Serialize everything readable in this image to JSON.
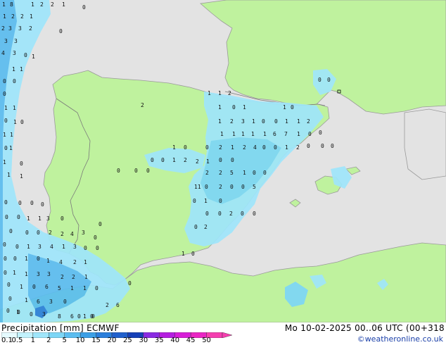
{
  "map": {
    "colors": {
      "sea": "#e3e3e3",
      "land": "#bff29e",
      "coast": "#9a9a9a",
      "border": "#7a7a7a"
    },
    "values": [
      {
        "label": "1"
      },
      {
        "label": "8"
      },
      {
        "label": "1"
      },
      {
        "label": "2"
      },
      {
        "label": "2"
      },
      {
        "label": "1"
      },
      {
        "label": "0"
      },
      {
        "label": "1"
      },
      {
        "label": "2"
      },
      {
        "label": "2"
      },
      {
        "label": "1"
      },
      {
        "label": "2"
      },
      {
        "label": "3"
      },
      {
        "label": "3"
      },
      {
        "label": "2"
      },
      {
        "label": "0"
      },
      {
        "label": "3"
      },
      {
        "label": "3"
      },
      {
        "label": "4"
      },
      {
        "label": "3"
      },
      {
        "label": "0"
      },
      {
        "label": "1"
      },
      {
        "label": "1"
      },
      {
        "label": "1"
      },
      {
        "label": "0"
      },
      {
        "label": "0"
      },
      {
        "label": "0"
      },
      {
        "label": "1"
      },
      {
        "label": "1"
      },
      {
        "label": "0"
      },
      {
        "label": "1"
      },
      {
        "label": "0"
      },
      {
        "label": "1"
      },
      {
        "label": "1"
      },
      {
        "label": "0"
      },
      {
        "label": "1"
      },
      {
        "label": "1"
      },
      {
        "label": "0"
      },
      {
        "label": "1"
      },
      {
        "label": "1"
      },
      {
        "label": "1"
      },
      {
        "label": "1"
      },
      {
        "label": "2"
      },
      {
        "label": "2"
      },
      {
        "label": "1"
      },
      {
        "label": "0"
      },
      {
        "label": "1"
      },
      {
        "label": "1"
      },
      {
        "label": "0"
      },
      {
        "label": "1"
      },
      {
        "label": "2"
      },
      {
        "label": "3"
      },
      {
        "label": "1"
      },
      {
        "label": "0"
      },
      {
        "label": "0"
      },
      {
        "label": "1"
      },
      {
        "label": "1"
      },
      {
        "label": "2"
      },
      {
        "label": "1"
      },
      {
        "label": "1"
      },
      {
        "label": "1"
      },
      {
        "label": "1"
      },
      {
        "label": "1"
      },
      {
        "label": "6"
      },
      {
        "label": "7"
      },
      {
        "label": "1"
      },
      {
        "label": "0"
      },
      {
        "label": "0"
      },
      {
        "label": "0"
      },
      {
        "label": "0"
      },
      {
        "label": "1"
      },
      {
        "label": "0"
      },
      {
        "label": "0"
      },
      {
        "label": "2"
      },
      {
        "label": "1"
      },
      {
        "label": "2"
      },
      {
        "label": "4"
      },
      {
        "label": "0"
      },
      {
        "label": "0"
      },
      {
        "label": "1"
      },
      {
        "label": "2"
      },
      {
        "label": "0"
      },
      {
        "label": "0"
      },
      {
        "label": "0"
      },
      {
        "label": "1"
      },
      {
        "label": "2"
      },
      {
        "label": "2"
      },
      {
        "label": "1"
      },
      {
        "label": "0"
      },
      {
        "label": "0"
      },
      {
        "label": "2"
      },
      {
        "label": "2"
      },
      {
        "label": "5"
      },
      {
        "label": "1"
      },
      {
        "label": "0"
      },
      {
        "label": "0"
      },
      {
        "label": "11"
      },
      {
        "label": "0"
      },
      {
        "label": "2"
      },
      {
        "label": "0"
      },
      {
        "label": "0"
      },
      {
        "label": "5"
      },
      {
        "label": "0"
      },
      {
        "label": "1"
      },
      {
        "label": "0"
      },
      {
        "label": "0"
      },
      {
        "label": "0"
      },
      {
        "label": "2"
      },
      {
        "label": "0"
      },
      {
        "label": "0"
      },
      {
        "label": "0"
      },
      {
        "label": "2"
      },
      {
        "label": "1"
      },
      {
        "label": "0"
      },
      {
        "label": "0"
      },
      {
        "label": "0"
      },
      {
        "label": "0"
      },
      {
        "label": "0"
      },
      {
        "label": "0"
      },
      {
        "label": "0"
      },
      {
        "label": "0"
      },
      {
        "label": "1"
      },
      {
        "label": "1"
      },
      {
        "label": "3"
      },
      {
        "label": "0"
      },
      {
        "label": "0"
      },
      {
        "label": "0"
      },
      {
        "label": "0"
      },
      {
        "label": "2"
      },
      {
        "label": "2"
      },
      {
        "label": "4"
      },
      {
        "label": "3"
      },
      {
        "label": "0"
      },
      {
        "label": "0"
      },
      {
        "label": "0"
      },
      {
        "label": "1"
      },
      {
        "label": "3"
      },
      {
        "label": "4"
      },
      {
        "label": "1"
      },
      {
        "label": "3"
      },
      {
        "label": "0"
      },
      {
        "label": "0"
      },
      {
        "label": "0"
      },
      {
        "label": "0"
      },
      {
        "label": "1"
      },
      {
        "label": "0"
      },
      {
        "label": "1"
      },
      {
        "label": "4"
      },
      {
        "label": "2"
      },
      {
        "label": "1"
      },
      {
        "label": "0"
      },
      {
        "label": "1"
      },
      {
        "label": "1"
      },
      {
        "label": "3"
      },
      {
        "label": "3"
      },
      {
        "label": "2"
      },
      {
        "label": "2"
      },
      {
        "label": "1"
      },
      {
        "label": "0"
      },
      {
        "label": "1"
      },
      {
        "label": "0"
      },
      {
        "label": "6"
      },
      {
        "label": "5"
      },
      {
        "label": "1"
      },
      {
        "label": "1"
      },
      {
        "label": "0"
      },
      {
        "label": "0"
      },
      {
        "label": "1"
      },
      {
        "label": "6"
      },
      {
        "label": "3"
      },
      {
        "label": "0"
      },
      {
        "label": "2"
      },
      {
        "label": "0"
      },
      {
        "label": "1"
      },
      {
        "label": "0"
      },
      {
        "label": "3"
      },
      {
        "label": "8"
      },
      {
        "label": "6"
      },
      {
        "label": "1"
      },
      {
        "label": "0"
      },
      {
        "label": "0"
      },
      {
        "label": "0"
      },
      {
        "label": "0"
      },
      {
        "label": "6"
      },
      {
        "label": "0"
      },
      {
        "label": "0"
      },
      {
        "label": "0"
      },
      {
        "label": "0"
      },
      {
        "label": "0"
      },
      {
        "label": "0"
      }
    ]
  },
  "footer": {
    "title_left": "Precipitation [mm] ECMWF",
    "title_right": "Mo 10-02-2025 00..06 UTC (00+318",
    "credit": "©weatheronline.co.uk",
    "scale": [
      {
        "label": "0.1",
        "color": "#e6fbff"
      },
      {
        "label": "0.5",
        "color": "#c2f2fd"
      },
      {
        "label": "1",
        "color": "#9fe6fb"
      },
      {
        "label": "2",
        "color": "#7dd6f6"
      },
      {
        "label": "5",
        "color": "#5bbdf0"
      },
      {
        "label": "10",
        "color": "#3c9fe6"
      },
      {
        "label": "15",
        "color": "#2b7fdc"
      },
      {
        "label": "20",
        "color": "#2060cc"
      },
      {
        "label": "25",
        "color": "#1640b8"
      },
      {
        "label": "30",
        "color": "#8a2be2"
      },
      {
        "label": "35",
        "color": "#b51fe0"
      },
      {
        "label": "40",
        "color": "#d71ed8"
      },
      {
        "label": "45",
        "color": "#ea25c4"
      },
      {
        "label": "50",
        "color": "#f53fb0"
      }
    ]
  }
}
